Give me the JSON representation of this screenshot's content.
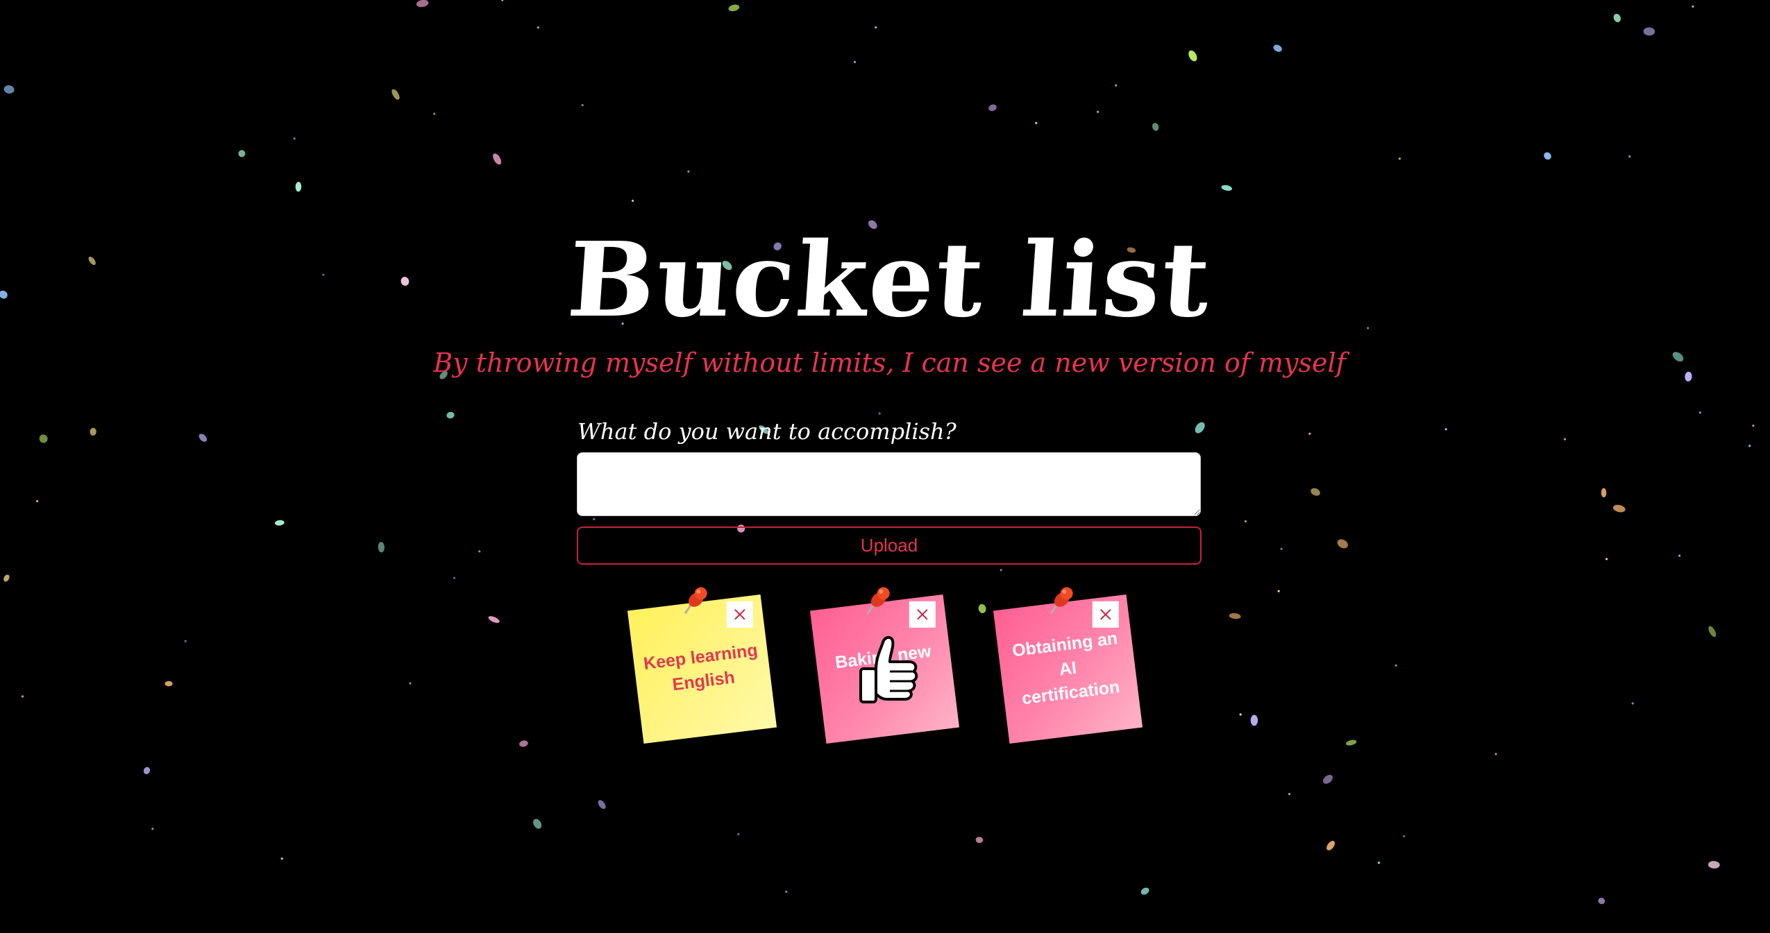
{
  "header": {
    "title": "Bucket list",
    "subtitle": "By throwing myself without limits, I can see a new version of myself"
  },
  "form": {
    "prompt_label": "What do you want to accomplish?",
    "input_value": "",
    "upload_label": "Upload"
  },
  "notes": [
    {
      "text": "Keep learning English",
      "color": "yellow",
      "close_icon": "close-icon",
      "pin_icon": "pushpin-icon"
    },
    {
      "text": "Baking new bread",
      "color": "pink",
      "close_icon": "close-icon",
      "pin_icon": "pushpin-icon"
    },
    {
      "text": "Obtaining an AI certification",
      "color": "pink",
      "close_icon": "close-icon",
      "pin_icon": "pushpin-icon"
    }
  ],
  "cursor": {
    "icon": "thumbs-up-hand-cursor-icon"
  },
  "colors": {
    "background": "#000000",
    "accent": "#e8334f",
    "note_yellow": "#fff15a",
    "note_pink": "#ff6f9e"
  }
}
